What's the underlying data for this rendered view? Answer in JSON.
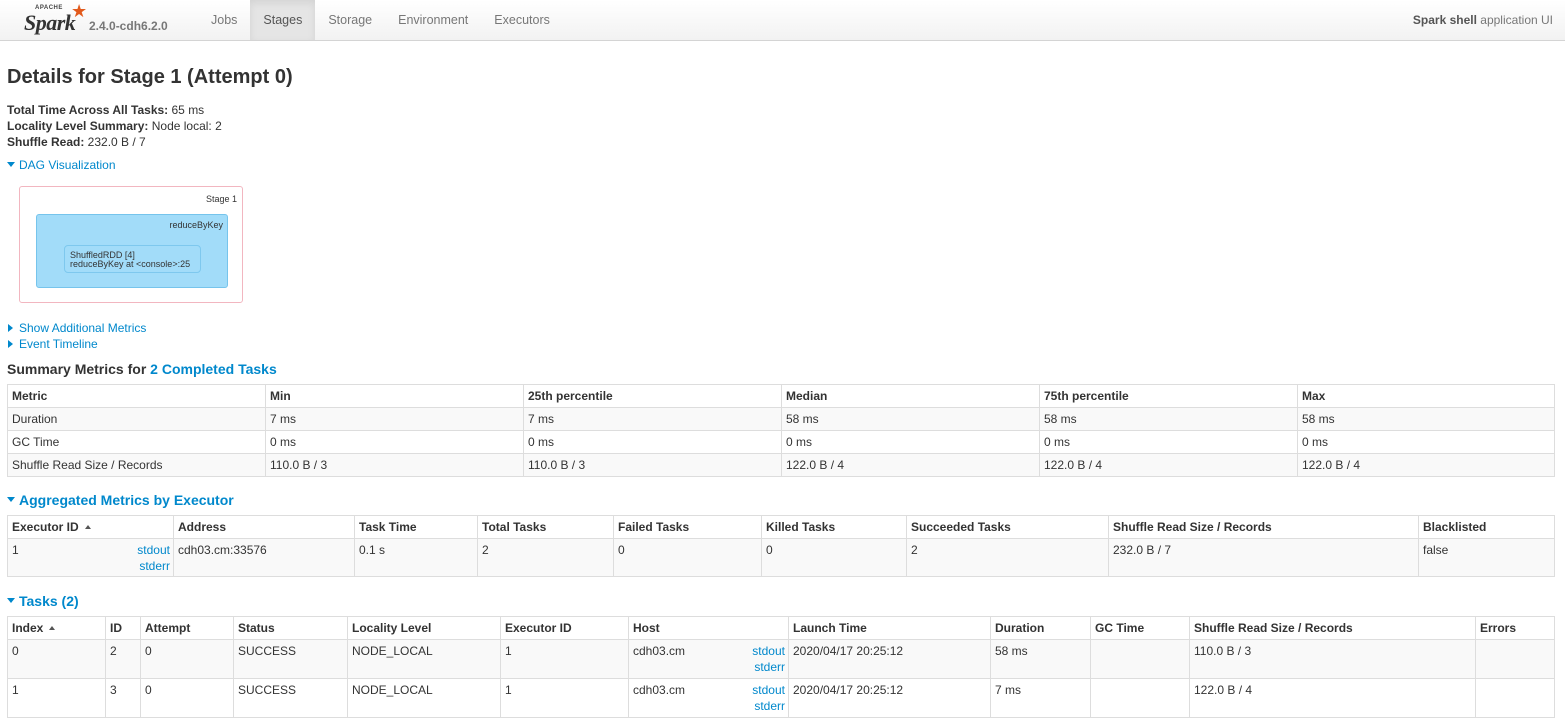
{
  "navbar": {
    "brand_small": "APACHE",
    "brand_name": "Spark",
    "version": "2.4.0-cdh6.2.0",
    "tabs": [
      {
        "label": "Jobs",
        "active": false
      },
      {
        "label": "Stages",
        "active": true
      },
      {
        "label": "Storage",
        "active": false
      },
      {
        "label": "Environment",
        "active": false
      },
      {
        "label": "Executors",
        "active": false
      }
    ],
    "app_name": "Spark shell",
    "app_suffix": " application UI"
  },
  "page": {
    "title": "Details for Stage 1 (Attempt 0)",
    "info": [
      {
        "label": "Total Time Across All Tasks:",
        "value": " 65 ms"
      },
      {
        "label": "Locality Level Summary:",
        "value": " Node local: 2"
      },
      {
        "label": "Shuffle Read:",
        "value": " 232.0 B / 7"
      }
    ],
    "dag_toggle": "DAG Visualization",
    "additional_metrics_toggle": "Show Additional Metrics",
    "event_timeline_toggle": "Event Timeline"
  },
  "dag": {
    "stage_label": "Stage 1",
    "cluster_label": "reduceByKey",
    "node_line1": "ShuffledRDD [4]",
    "node_line2": "reduceByKey at <console>:25"
  },
  "summary": {
    "title_prefix": "Summary Metrics for ",
    "title_link": "2 Completed Tasks",
    "headers": [
      "Metric",
      "Min",
      "25th percentile",
      "Median",
      "75th percentile",
      "Max"
    ],
    "rows": [
      [
        "Duration",
        "7 ms",
        "7 ms",
        "58 ms",
        "58 ms",
        "58 ms"
      ],
      [
        "GC Time",
        "0 ms",
        "0 ms",
        "0 ms",
        "0 ms",
        "0 ms"
      ],
      [
        "Shuffle Read Size / Records",
        "110.0 B / 3",
        "110.0 B / 3",
        "122.0 B / 4",
        "122.0 B / 4",
        "122.0 B / 4"
      ]
    ]
  },
  "executors": {
    "title": "Aggregated Metrics by Executor",
    "headers": [
      "Executor ID",
      "Address",
      "Task Time",
      "Total Tasks",
      "Failed Tasks",
      "Killed Tasks",
      "Succeeded Tasks",
      "Shuffle Read Size / Records",
      "Blacklisted"
    ],
    "rows": [
      {
        "id": "1",
        "stdout": "stdout",
        "stderr": "stderr",
        "address": "cdh03.cm:33576",
        "task_time": "0.1 s",
        "total": "2",
        "failed": "0",
        "killed": "0",
        "succeeded": "2",
        "shuffle_read": "232.0 B / 7",
        "blacklisted": "false"
      }
    ]
  },
  "tasks": {
    "title": "Tasks (2)",
    "headers": [
      "Index",
      "ID",
      "Attempt",
      "Status",
      "Locality Level",
      "Executor ID",
      "Host",
      "Launch Time",
      "Duration",
      "GC Time",
      "Shuffle Read Size / Records",
      "Errors"
    ],
    "rows": [
      {
        "index": "0",
        "id": "2",
        "attempt": "0",
        "status": "SUCCESS",
        "locality": "NODE_LOCAL",
        "executor": "1",
        "host": "cdh03.cm",
        "stdout": "stdout",
        "stderr": "stderr",
        "launch": "2020/04/17 20:25:12",
        "duration": "58 ms",
        "gc": "",
        "shuffle_read": "110.0 B / 3",
        "errors": ""
      },
      {
        "index": "1",
        "id": "3",
        "attempt": "0",
        "status": "SUCCESS",
        "locality": "NODE_LOCAL",
        "executor": "1",
        "host": "cdh03.cm",
        "stdout": "stdout",
        "stderr": "stderr",
        "launch": "2020/04/17 20:25:12",
        "duration": "7 ms",
        "gc": "",
        "shuffle_read": "122.0 B / 4",
        "errors": ""
      }
    ]
  },
  "colors": {
    "link": "#0088cc",
    "spark_orange": "#e25a1c",
    "dag_cluster": "#a2dcf9",
    "dag_stage_border": "#f2b6c0"
  }
}
